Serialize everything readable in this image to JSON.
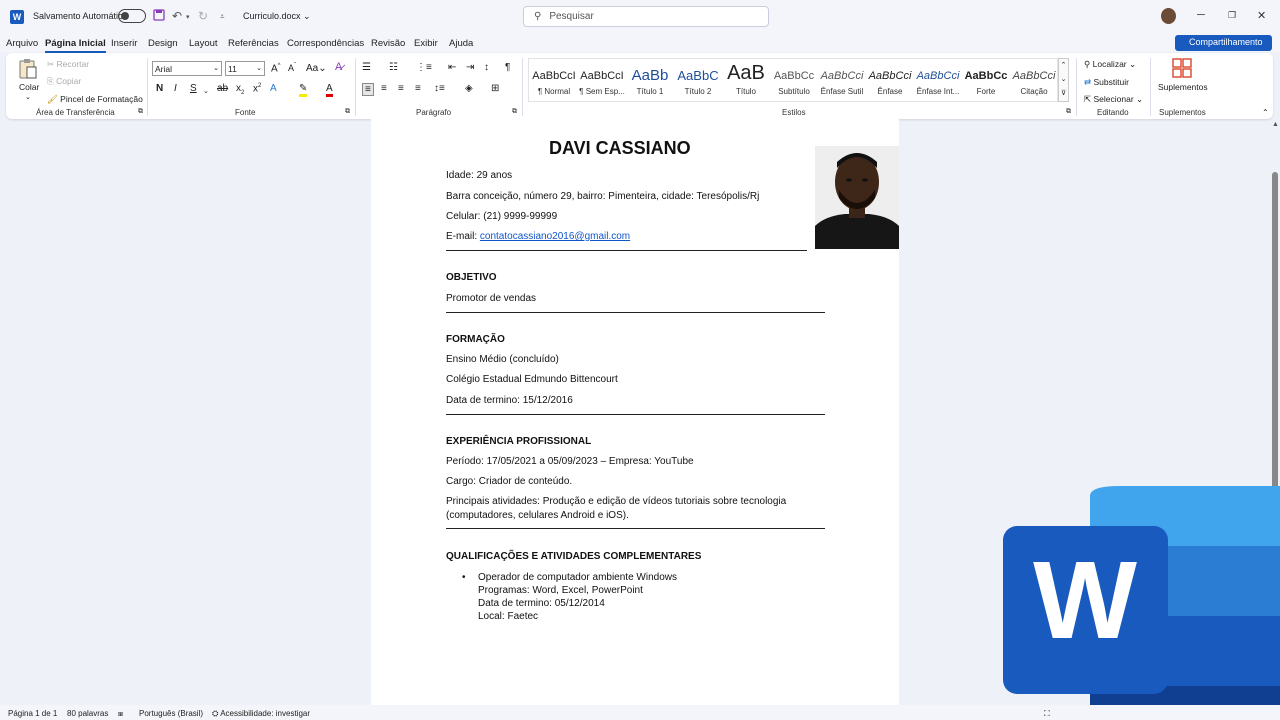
{
  "titlebar": {
    "autosave_label": "Salvamento Automático",
    "doc_name": "Curriculo.docx",
    "search_placeholder": "Pesquisar",
    "app_letter": "W"
  },
  "menu": {
    "items": [
      "Arquivo",
      "Página Inicial",
      "Inserir",
      "Design",
      "Layout",
      "Referências",
      "Correspondências",
      "Revisão",
      "Exibir",
      "Ajuda"
    ],
    "share_label": "Compartilhamento"
  },
  "ribbon": {
    "clipboard": {
      "paste": "Colar",
      "cut": "Recortar",
      "copy": "Copiar",
      "painter": "Pincel de Formatação",
      "group": "Área de Transferência"
    },
    "font": {
      "name": "Arial",
      "size": "11",
      "group": "Fonte"
    },
    "paragraph": {
      "group": "Parágrafo"
    },
    "styles": {
      "group": "Estilos",
      "items": [
        {
          "sample": "AaBbCcI",
          "name": "¶ Normal"
        },
        {
          "sample": "AaBbCcI",
          "name": "¶ Sem Esp..."
        },
        {
          "sample": "AaBb",
          "name": "Título 1"
        },
        {
          "sample": "AaBbC",
          "name": "Título 2"
        },
        {
          "sample": "AaB",
          "name": "Título"
        },
        {
          "sample": "AaBbCc",
          "name": "Subtítulo"
        },
        {
          "sample": "AaBbCci",
          "name": "Ênfase Sutil"
        },
        {
          "sample": "AaBbCci",
          "name": "Ênfase"
        },
        {
          "sample": "AaBbCci",
          "name": "Ênfase Int..."
        },
        {
          "sample": "AaBbCc",
          "name": "Forte"
        },
        {
          "sample": "AaBbCci",
          "name": "Citação"
        }
      ]
    },
    "editing": {
      "find": "Localizar",
      "replace": "Substituir",
      "select": "Selecionar",
      "group": "Editando"
    },
    "addins": {
      "label": "Suplementos",
      "group": "Suplementos"
    }
  },
  "document": {
    "name": "DAVI CASSIANO",
    "age": "Idade: 29 anos",
    "address": "Barra conceição, número 29, bairro: Pimenteira, cidade: Teresópolis/Rj",
    "phone": "Celular: (21) 9999-99999",
    "email_label": "E-mail: ",
    "email": "contatocassiano2016@gmail.com",
    "objective_heading": "OBJETIVO",
    "objective": "Promotor de vendas",
    "education_heading": "FORMAÇÃO",
    "education_1": "Ensino Médio (concluído)",
    "education_2": "Colégio Estadual Edmundo Bittencourt",
    "education_3": "Data de termino: 15/12/2016",
    "experience_heading": "EXPERIÊNCIA PROFISSIONAL",
    "experience_1": "Período: 17/05/2021 a 05/09/2023 – Empresa: YouTube",
    "experience_2": "Cargo: Criador de conteúdo.",
    "experience_3a": "Principais atividades: Produção e edição de vídeos tutoriais sobre tecnologia",
    "experience_3b": "(computadores, celulares Android e iOS).",
    "qual_heading": "QUALIFICAÇÕES E ATIVIDADES COMPLEMENTARES",
    "qual_1": "Operador de computador ambiente Windows",
    "qual_2": "Programas: Word, Excel, PowerPoint",
    "qual_3": "Data de termino: 05/12/2014",
    "qual_4": "Local: Faetec"
  },
  "status": {
    "page": "Página 1 de 1",
    "words": "80 palavras",
    "language": "Português (Brasil)",
    "accessibility": "Acessibilidade: investigar"
  },
  "colors": {
    "accent": "#185abd",
    "link": "#1155cc"
  }
}
